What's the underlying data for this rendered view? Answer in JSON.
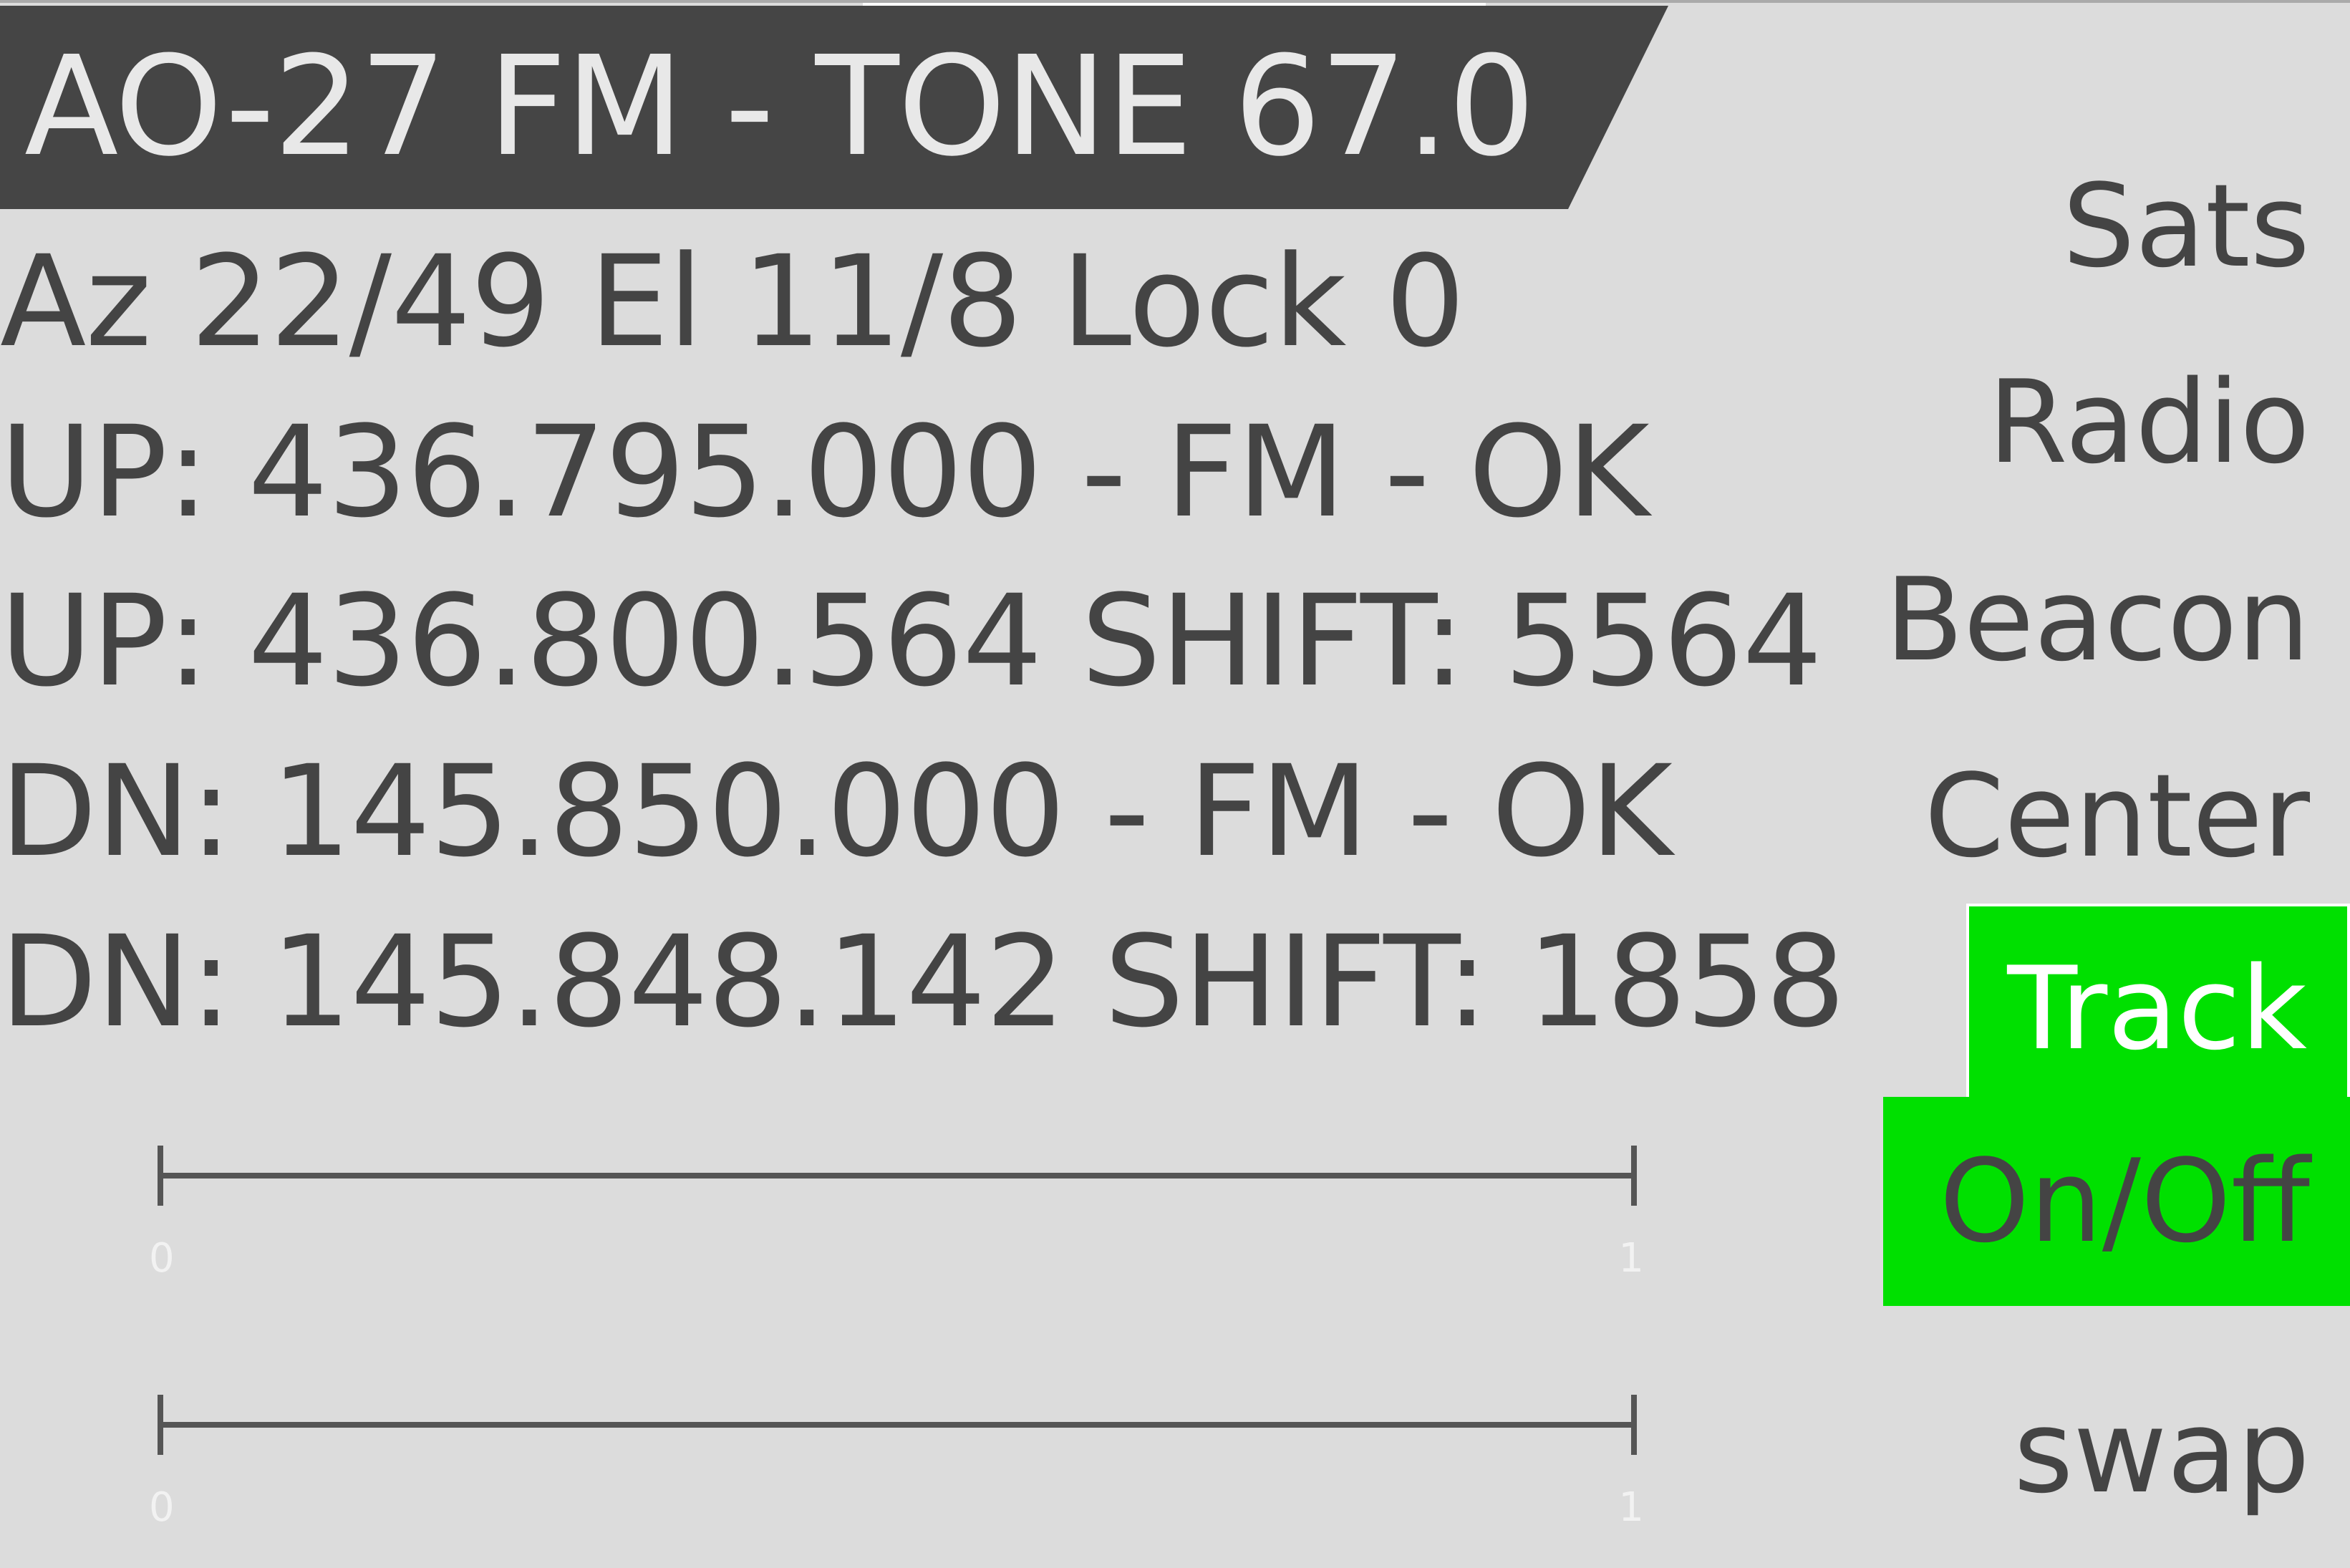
{
  "header": {
    "title": "AO-27 FM - TONE 67.0"
  },
  "status": {
    "lines": [
      "Az 22/49 El 11/8 Lock 0",
      "UP: 436.795.000 - FM - OK",
      "UP: 436.800.564 SHIFT: 5564",
      "DN: 145.850.000 - FM - OK",
      "DN: 145.848.142 SHIFT: 1858"
    ]
  },
  "menu": {
    "sats": "Sats",
    "radio": "Radio",
    "beacon": "Beacon",
    "center": "Center",
    "track": "Track",
    "onoff": "On/Off",
    "swap": "swap"
  },
  "sliders": [
    {
      "min_label": "0",
      "max_label": "1",
      "value": 0
    },
    {
      "min_label": "0",
      "max_label": "1",
      "value": 0
    }
  ],
  "colors": {
    "background": "#dcdcdc",
    "title_bar": "#454545",
    "active_green": "#00e000",
    "text": "#444444"
  }
}
